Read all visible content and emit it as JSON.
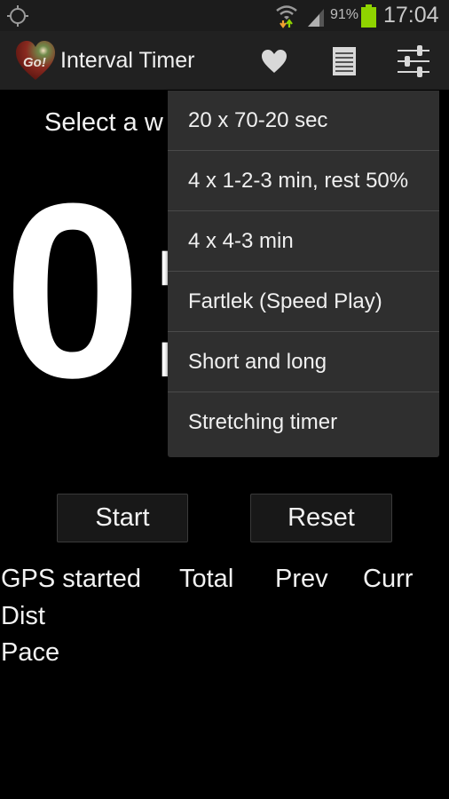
{
  "status_bar": {
    "battery_percent": "91%",
    "time": "17:04",
    "icons": [
      "gps-icon",
      "wifi-icon",
      "signal-icon",
      "battery-icon"
    ],
    "battery_color": "#8fd400"
  },
  "action_bar": {
    "logo_text": "Go!",
    "title": "Interval Timer",
    "actions": [
      "heart-icon",
      "list-icon",
      "settings-sliders-icon"
    ]
  },
  "main": {
    "select_label": "Select a w",
    "timer_value": "0:"
  },
  "buttons": {
    "start": "Start",
    "reset": "Reset"
  },
  "stats": {
    "gps_status": "GPS started",
    "columns": [
      "Total",
      "Prev",
      "Curr"
    ],
    "rows": [
      "Dist",
      "Pace"
    ]
  },
  "dropdown_menu": {
    "items": [
      "20 x 70-20 sec",
      "4 x 1-2-3 min, rest 50%",
      "4 x 4-3 min",
      "Fartlek (Speed Play)",
      "Short and long",
      "Stretching timer"
    ]
  }
}
